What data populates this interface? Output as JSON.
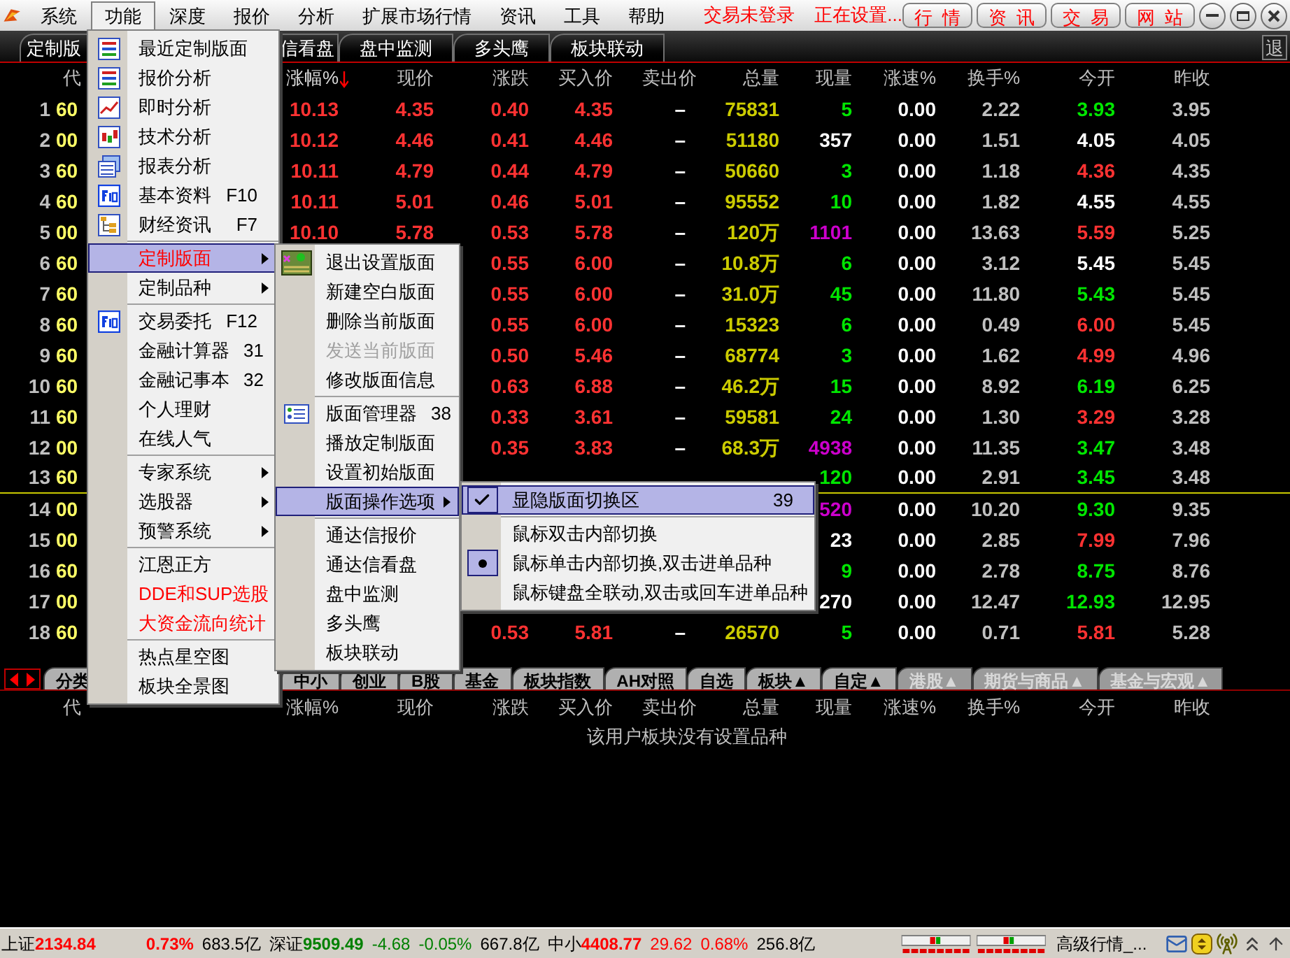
{
  "menubar": {
    "items": [
      {
        "label": "系统",
        "selected": false
      },
      {
        "label": "功能",
        "selected": true
      },
      {
        "label": "深度",
        "selected": false
      },
      {
        "label": "报价",
        "selected": false
      },
      {
        "label": "分析",
        "selected": false
      },
      {
        "label": "扩展市场行情",
        "selected": false
      },
      {
        "label": "资讯",
        "selected": false
      },
      {
        "label": "工具",
        "selected": false
      },
      {
        "label": "帮助",
        "selected": false
      }
    ]
  },
  "status_messages": [
    "交易未登录",
    "正在设置..."
  ],
  "quick_buttons": [
    "行  情",
    "资  讯",
    "交  易",
    "网  站"
  ],
  "top_tabs": [
    {
      "label": "定制版",
      "selected": false
    },
    {
      "label": "信看盘",
      "selected": false
    },
    {
      "label": "盘中监测",
      "selected": false
    },
    {
      "label": "多头鹰",
      "selected": false
    },
    {
      "label": "板块联动",
      "selected": false
    }
  ],
  "exit_button": "退",
  "table": {
    "columns": [
      {
        "label": "代",
        "sorted": false
      },
      {
        "label": "涨幅%",
        "sorted": true
      },
      {
        "label": "现价",
        "sorted": false
      },
      {
        "label": "涨跌",
        "sorted": false
      },
      {
        "label": "买入价",
        "sorted": false
      },
      {
        "label": "卖出价",
        "sorted": false
      },
      {
        "label": "总量",
        "sorted": false
      },
      {
        "label": "现量",
        "sorted": false
      },
      {
        "label": "涨速%",
        "sorted": false
      },
      {
        "label": "换手%",
        "sorted": false
      },
      {
        "label": "今开",
        "sorted": false
      },
      {
        "label": "昨收",
        "sorted": false
      }
    ],
    "rows": [
      {
        "num": "1",
        "underlined": false,
        "cells": [
          {
            "text": "60",
            "color": "#ffff66"
          },
          {
            "text": "10.13",
            "color": "#ff3232"
          },
          {
            "text": "4.35",
            "color": "#ff3232"
          },
          {
            "text": "0.40",
            "color": "#ff3232"
          },
          {
            "text": "4.35",
            "color": "#ff3232"
          },
          {
            "text": "–",
            "color": "#ffffff"
          },
          {
            "text": "75831",
            "color": "#cccc00"
          },
          {
            "text": "5",
            "color": "#00e600"
          },
          {
            "text": "0.00",
            "color": "#ffffff"
          },
          {
            "text": "2.22",
            "color": "#c0c0c0"
          },
          {
            "text": "3.93",
            "color": "#00e600"
          },
          {
            "text": "3.95",
            "color": "#c0c0c0"
          }
        ]
      },
      {
        "num": "2",
        "underlined": false,
        "cells": [
          {
            "text": "00",
            "color": "#ffff66"
          },
          {
            "text": "10.12",
            "color": "#ff3232"
          },
          {
            "text": "4.46",
            "color": "#ff3232"
          },
          {
            "text": "0.41",
            "color": "#ff3232"
          },
          {
            "text": "4.46",
            "color": "#ff3232"
          },
          {
            "text": "–",
            "color": "#ffffff"
          },
          {
            "text": "51180",
            "color": "#cccc00"
          },
          {
            "text": "357",
            "color": "#ffffff"
          },
          {
            "text": "0.00",
            "color": "#ffffff"
          },
          {
            "text": "1.51",
            "color": "#c0c0c0"
          },
          {
            "text": "4.05",
            "color": "#ffffff"
          },
          {
            "text": "4.05",
            "color": "#c0c0c0"
          }
        ]
      },
      {
        "num": "3",
        "underlined": false,
        "cells": [
          {
            "text": "60",
            "color": "#ffff66"
          },
          {
            "text": "10.11",
            "color": "#ff3232"
          },
          {
            "text": "4.79",
            "color": "#ff3232"
          },
          {
            "text": "0.44",
            "color": "#ff3232"
          },
          {
            "text": "4.79",
            "color": "#ff3232"
          },
          {
            "text": "–",
            "color": "#ffffff"
          },
          {
            "text": "50660",
            "color": "#cccc00"
          },
          {
            "text": "3",
            "color": "#00e600"
          },
          {
            "text": "0.00",
            "color": "#ffffff"
          },
          {
            "text": "1.18",
            "color": "#c0c0c0"
          },
          {
            "text": "4.36",
            "color": "#ff3232"
          },
          {
            "text": "4.35",
            "color": "#c0c0c0"
          }
        ]
      },
      {
        "num": "4",
        "underlined": false,
        "cells": [
          {
            "text": "60",
            "color": "#ffff66"
          },
          {
            "text": "10.11",
            "color": "#ff3232"
          },
          {
            "text": "5.01",
            "color": "#ff3232"
          },
          {
            "text": "0.46",
            "color": "#ff3232"
          },
          {
            "text": "5.01",
            "color": "#ff3232"
          },
          {
            "text": "–",
            "color": "#ffffff"
          },
          {
            "text": "95552",
            "color": "#cccc00"
          },
          {
            "text": "10",
            "color": "#00e600"
          },
          {
            "text": "0.00",
            "color": "#ffffff"
          },
          {
            "text": "1.82",
            "color": "#c0c0c0"
          },
          {
            "text": "4.55",
            "color": "#ffffff"
          },
          {
            "text": "4.55",
            "color": "#c0c0c0"
          }
        ]
      },
      {
        "num": "5",
        "underlined": false,
        "cells": [
          {
            "text": "00",
            "color": "#ffff66"
          },
          {
            "text": "10.10",
            "color": "#ff3232"
          },
          {
            "text": "5.78",
            "color": "#ff3232"
          },
          {
            "text": "0.53",
            "color": "#ff3232"
          },
          {
            "text": "5.78",
            "color": "#ff3232"
          },
          {
            "text": "–",
            "color": "#ffffff"
          },
          {
            "text": "120万",
            "color": "#cccc00"
          },
          {
            "text": "1101",
            "color": "#cc00cc"
          },
          {
            "text": "0.00",
            "color": "#ffffff"
          },
          {
            "text": "13.63",
            "color": "#c0c0c0"
          },
          {
            "text": "5.59",
            "color": "#ff3232"
          },
          {
            "text": "5.25",
            "color": "#c0c0c0"
          }
        ]
      },
      {
        "num": "6",
        "underlined": false,
        "cells": [
          {
            "text": "60",
            "color": "#ffff66"
          },
          null,
          null,
          {
            "text": "0.55",
            "color": "#ff3232"
          },
          {
            "text": "6.00",
            "color": "#ff3232"
          },
          {
            "text": "–",
            "color": "#ffffff"
          },
          {
            "text": "10.8万",
            "color": "#cccc00"
          },
          {
            "text": "6",
            "color": "#00e600"
          },
          {
            "text": "0.00",
            "color": "#ffffff"
          },
          {
            "text": "3.12",
            "color": "#c0c0c0"
          },
          {
            "text": "5.45",
            "color": "#ffffff"
          },
          {
            "text": "5.45",
            "color": "#c0c0c0"
          }
        ]
      },
      {
        "num": "7",
        "underlined": false,
        "cells": [
          {
            "text": "60",
            "color": "#ffff66"
          },
          null,
          null,
          {
            "text": "0.55",
            "color": "#ff3232"
          },
          {
            "text": "6.00",
            "color": "#ff3232"
          },
          {
            "text": "–",
            "color": "#ffffff"
          },
          {
            "text": "31.0万",
            "color": "#cccc00"
          },
          {
            "text": "45",
            "color": "#00e600"
          },
          {
            "text": "0.00",
            "color": "#ffffff"
          },
          {
            "text": "11.80",
            "color": "#c0c0c0"
          },
          {
            "text": "5.43",
            "color": "#00e600"
          },
          {
            "text": "5.45",
            "color": "#c0c0c0"
          }
        ]
      },
      {
        "num": "8",
        "underlined": false,
        "cells": [
          {
            "text": "60",
            "color": "#ffff66"
          },
          null,
          null,
          {
            "text": "0.55",
            "color": "#ff3232"
          },
          {
            "text": "6.00",
            "color": "#ff3232"
          },
          {
            "text": "–",
            "color": "#ffffff"
          },
          {
            "text": "15323",
            "color": "#cccc00"
          },
          {
            "text": "6",
            "color": "#00e600"
          },
          {
            "text": "0.00",
            "color": "#ffffff"
          },
          {
            "text": "0.49",
            "color": "#c0c0c0"
          },
          {
            "text": "6.00",
            "color": "#ff3232"
          },
          {
            "text": "5.45",
            "color": "#c0c0c0"
          }
        ]
      },
      {
        "num": "9",
        "underlined": false,
        "cells": [
          {
            "text": "60",
            "color": "#ffff66"
          },
          null,
          null,
          {
            "text": "0.50",
            "color": "#ff3232"
          },
          {
            "text": "5.46",
            "color": "#ff3232"
          },
          {
            "text": "–",
            "color": "#ffffff"
          },
          {
            "text": "68774",
            "color": "#cccc00"
          },
          {
            "text": "3",
            "color": "#00e600"
          },
          {
            "text": "0.00",
            "color": "#ffffff"
          },
          {
            "text": "1.62",
            "color": "#c0c0c0"
          },
          {
            "text": "4.99",
            "color": "#ff3232"
          },
          {
            "text": "4.96",
            "color": "#c0c0c0"
          }
        ]
      },
      {
        "num": "10",
        "underlined": false,
        "cells": [
          {
            "text": "60",
            "color": "#ffff66"
          },
          null,
          null,
          {
            "text": "0.63",
            "color": "#ff3232"
          },
          {
            "text": "6.88",
            "color": "#ff3232"
          },
          {
            "text": "–",
            "color": "#ffffff"
          },
          {
            "text": "46.2万",
            "color": "#cccc00"
          },
          {
            "text": "15",
            "color": "#00e600"
          },
          {
            "text": "0.00",
            "color": "#ffffff"
          },
          {
            "text": "8.92",
            "color": "#c0c0c0"
          },
          {
            "text": "6.19",
            "color": "#00e600"
          },
          {
            "text": "6.25",
            "color": "#c0c0c0"
          }
        ]
      },
      {
        "num": "11",
        "underlined": false,
        "cells": [
          {
            "text": "60",
            "color": "#ffff66"
          },
          null,
          null,
          {
            "text": "0.33",
            "color": "#ff3232"
          },
          {
            "text": "3.61",
            "color": "#ff3232"
          },
          {
            "text": "–",
            "color": "#ffffff"
          },
          {
            "text": "59581",
            "color": "#cccc00"
          },
          {
            "text": "24",
            "color": "#00e600"
          },
          {
            "text": "0.00",
            "color": "#ffffff"
          },
          {
            "text": "1.30",
            "color": "#c0c0c0"
          },
          {
            "text": "3.29",
            "color": "#ff3232"
          },
          {
            "text": "3.28",
            "color": "#c0c0c0"
          }
        ]
      },
      {
        "num": "12",
        "underlined": false,
        "cells": [
          {
            "text": "00",
            "color": "#ffff66"
          },
          null,
          null,
          {
            "text": "0.35",
            "color": "#ff3232"
          },
          {
            "text": "3.83",
            "color": "#ff3232"
          },
          {
            "text": "–",
            "color": "#ffffff"
          },
          {
            "text": "68.3万",
            "color": "#cccc00"
          },
          {
            "text": "4938",
            "color": "#cc00cc"
          },
          {
            "text": "0.00",
            "color": "#ffffff"
          },
          {
            "text": "11.35",
            "color": "#c0c0c0"
          },
          {
            "text": "3.47",
            "color": "#00e600"
          },
          {
            "text": "3.48",
            "color": "#c0c0c0"
          }
        ]
      },
      {
        "num": "13",
        "underlined": true,
        "cells": [
          {
            "text": "60",
            "color": "#ffff66"
          },
          null,
          null,
          null,
          null,
          null,
          null,
          {
            "text": "120",
            "color": "#00e600"
          },
          {
            "text": "0.00",
            "color": "#ffffff"
          },
          {
            "text": "2.91",
            "color": "#c0c0c0"
          },
          {
            "text": "3.45",
            "color": "#00e600"
          },
          {
            "text": "3.48",
            "color": "#c0c0c0"
          }
        ]
      },
      {
        "num": "14",
        "underlined": false,
        "cells": [
          {
            "text": "00",
            "color": "#ffff66"
          },
          null,
          null,
          null,
          null,
          null,
          null,
          {
            "text": "520",
            "color": "#cc00cc"
          },
          {
            "text": "0.00",
            "color": "#ffffff"
          },
          {
            "text": "10.20",
            "color": "#c0c0c0"
          },
          {
            "text": "9.30",
            "color": "#00e600"
          },
          {
            "text": "9.35",
            "color": "#c0c0c0"
          }
        ]
      },
      {
        "num": "15",
        "underlined": false,
        "cells": [
          {
            "text": "00",
            "color": "#ffff66"
          },
          null,
          null,
          null,
          null,
          null,
          null,
          {
            "text": "23",
            "color": "#ffffff"
          },
          {
            "text": "0.00",
            "color": "#ffffff"
          },
          {
            "text": "2.85",
            "color": "#c0c0c0"
          },
          {
            "text": "7.99",
            "color": "#ff3232"
          },
          {
            "text": "7.96",
            "color": "#c0c0c0"
          }
        ]
      },
      {
        "num": "16",
        "underlined": false,
        "cells": [
          {
            "text": "60",
            "color": "#ffff66"
          },
          null,
          null,
          null,
          null,
          null,
          null,
          {
            "text": "9",
            "color": "#00e600"
          },
          {
            "text": "0.00",
            "color": "#ffffff"
          },
          {
            "text": "2.78",
            "color": "#c0c0c0"
          },
          {
            "text": "8.75",
            "color": "#00e600"
          },
          {
            "text": "8.76",
            "color": "#c0c0c0"
          }
        ]
      },
      {
        "num": "17",
        "underlined": false,
        "cells": [
          {
            "text": "00",
            "color": "#ffff66"
          },
          null,
          null,
          null,
          null,
          null,
          null,
          {
            "text": "270",
            "color": "#ffffff"
          },
          {
            "text": "0.00",
            "color": "#ffffff"
          },
          {
            "text": "12.47",
            "color": "#c0c0c0"
          },
          {
            "text": "12.93",
            "color": "#00e600"
          },
          {
            "text": "12.95",
            "color": "#c0c0c0"
          }
        ]
      },
      {
        "num": "18",
        "underlined": false,
        "cells": [
          {
            "text": "60",
            "color": "#ffff66"
          },
          null,
          null,
          {
            "text": "0.53",
            "color": "#ff3232"
          },
          {
            "text": "5.81",
            "color": "#ff3232"
          },
          {
            "text": "–",
            "color": "#ffffff"
          },
          {
            "text": "26570",
            "color": "#cccc00"
          },
          {
            "text": "5",
            "color": "#00e600"
          },
          {
            "text": "0.00",
            "color": "#ffffff"
          },
          {
            "text": "0.71",
            "color": "#c0c0c0"
          },
          {
            "text": "5.81",
            "color": "#ff3232"
          },
          {
            "text": "5.28",
            "color": "#c0c0c0"
          }
        ]
      }
    ]
  },
  "bottom_tabs": [
    {
      "label": "分类",
      "disabled": false
    },
    {
      "label": "中小",
      "disabled": false
    },
    {
      "label": "创业",
      "disabled": false
    },
    {
      "label": "B股",
      "disabled": false
    },
    {
      "label": "基金",
      "disabled": false
    },
    {
      "label": "板块指数",
      "disabled": false
    },
    {
      "label": "AH对照",
      "disabled": false
    },
    {
      "label": "自选",
      "disabled": false
    },
    {
      "label": "板块▲",
      "disabled": false
    },
    {
      "label": "自定▲",
      "disabled": false
    },
    {
      "label": "港股▲",
      "disabled": true
    },
    {
      "label": "期货与商品▲",
      "disabled": true
    },
    {
      "label": "基金与宏观▲",
      "disabled": true
    }
  ],
  "board_table": {
    "columns": [
      "代",
      "涨幅%",
      "现价",
      "涨跌",
      "买入价",
      "卖出价",
      "总量",
      "现量",
      "涨速%",
      "换手%",
      "今开",
      "昨收"
    ],
    "message": "该用户板块没有设置品种"
  },
  "status_bar": {
    "items": [
      {
        "text": "上证",
        "color": "#000000"
      },
      {
        "text": "2134.84",
        "color": "#ff0000"
      },
      {
        "text": "0.73%",
        "color": "#ff0000"
      },
      {
        "text": "683.5亿",
        "color": "#000000"
      },
      {
        "text": "深证",
        "color": "#000000"
      },
      {
        "text": "9509.49",
        "color": "#008000"
      },
      {
        "text": "-4.68",
        "color": "#008000"
      },
      {
        "text": "-0.05%",
        "color": "#008000"
      },
      {
        "text": "667.8亿",
        "color": "#000000"
      },
      {
        "text": "中小",
        "color": "#000000"
      },
      {
        "text": "4408.77",
        "color": "#ff0000"
      },
      {
        "text": "29.62",
        "color": "#ff0000"
      },
      {
        "text": "0.68%",
        "color": "#ff0000"
      },
      {
        "text": "256.8亿",
        "color": "#000000"
      }
    ],
    "feed_label": "高级行情_..."
  },
  "menus": [
    {
      "groups": [
        [
          {
            "label": "最近定制版面",
            "selected": false
          },
          {
            "label": "报价分析",
            "selected": false
          },
          {
            "label": "即时分析",
            "selected": false
          },
          {
            "label": "技术分析",
            "selected": false
          },
          {
            "label": "报表分析",
            "selected": false
          },
          {
            "label": "基本资料",
            "shortcut": "F10",
            "selected": false
          },
          {
            "label": "财经资讯",
            "shortcut": "F7",
            "selected": false
          }
        ],
        [
          {
            "label": "定制版面",
            "submenu": true,
            "selected": true,
            "color": "#ff0000"
          },
          {
            "label": "定制品种",
            "submenu": true,
            "selected": false
          }
        ],
        [
          {
            "label": "交易委托",
            "shortcut": "F12",
            "selected": false
          },
          {
            "label": "金融计算器",
            "shortcut": "31",
            "selected": false
          },
          {
            "label": "金融记事本",
            "shortcut": "32",
            "selected": false
          },
          {
            "label": "个人理财",
            "selected": false
          },
          {
            "label": "在线人气",
            "selected": false
          }
        ],
        [
          {
            "label": "专家系统",
            "submenu": true,
            "selected": false
          },
          {
            "label": "选股器",
            "submenu": true,
            "selected": false
          },
          {
            "label": "预警系统",
            "submenu": true,
            "selected": false
          }
        ],
        [
          {
            "label": "江恩正方",
            "selected": false
          },
          {
            "label": "DDE和SUP选股",
            "selected": false,
            "color": "#ff0000"
          },
          {
            "label": "大资金流向统计",
            "selected": false,
            "color": "#ff0000"
          }
        ],
        [
          {
            "label": "热点星空图",
            "selected": false
          },
          {
            "label": "板块全景图",
            "selected": false
          }
        ]
      ]
    },
    {
      "groups": [
        [
          {
            "label": "退出设置版面",
            "selected": false,
            "disabled": false
          },
          {
            "label": "新建空白版面",
            "selected": false,
            "disabled": false
          },
          {
            "label": "删除当前版面",
            "selected": false,
            "disabled": false
          },
          {
            "label": "发送当前版面",
            "selected": false,
            "disabled": true
          },
          {
            "label": "修改版面信息",
            "selected": false,
            "disabled": false
          }
        ],
        [
          {
            "label": "版面管理器",
            "shortcut": "38",
            "selected": false,
            "disabled": false
          },
          {
            "label": "播放定制版面",
            "selected": false,
            "disabled": false
          },
          {
            "label": "设置初始版面",
            "selected": false,
            "disabled": false
          },
          {
            "label": "版面操作选项",
            "submenu": true,
            "selected": true,
            "disabled": false
          }
        ],
        [
          {
            "label": "通达信报价",
            "selected": false,
            "disabled": false
          },
          {
            "label": "通达信看盘",
            "selected": false,
            "disabled": false
          },
          {
            "label": "盘中监测",
            "selected": false,
            "disabled": false
          },
          {
            "label": "多头鹰",
            "selected": false,
            "disabled": false
          },
          {
            "label": "板块联动",
            "selected": false,
            "disabled": false
          }
        ]
      ]
    },
    {
      "groups": [
        [
          {
            "label": "显隐版面切换区",
            "shortcut": "39",
            "kind": "check",
            "checked": true,
            "selected": true
          }
        ],
        [
          {
            "label": "鼠标双击内部切换",
            "kind": "radio",
            "checked": false,
            "selected": false
          },
          {
            "label": "鼠标单击内部切换,双击进单品种",
            "kind": "radio",
            "checked": true,
            "selected": false
          },
          {
            "label": "鼠标键盘全联动,双击或回车进单品种",
            "kind": "radio",
            "checked": false,
            "selected": false
          }
        ]
      ]
    }
  ]
}
